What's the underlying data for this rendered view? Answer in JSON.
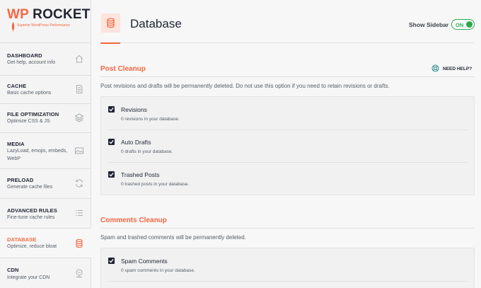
{
  "brand": {
    "logo_wp": "WP",
    "logo_rocket": "ROCKET",
    "tagline": "Superior WordPress Performance"
  },
  "nav": [
    {
      "title": "DASHBOARD",
      "desc": "Get help, account info",
      "icon": "home-icon"
    },
    {
      "title": "CACHE",
      "desc": "Basic cache options",
      "icon": "document-icon"
    },
    {
      "title": "FILE OPTIMIZATION",
      "desc": "Optimize CSS & JS",
      "icon": "layers-icon"
    },
    {
      "title": "MEDIA",
      "desc": "LazyLoad, emojis, embeds, WebP",
      "icon": "image-icon"
    },
    {
      "title": "PRELOAD",
      "desc": "Generate cache files",
      "icon": "refresh-icon"
    },
    {
      "title": "ADVANCED RULES",
      "desc": "Fine-tune cache rules",
      "icon": "list-icon"
    },
    {
      "title": "DATABASE",
      "desc": "Optimize, reduce bloat",
      "icon": "database-icon",
      "active": true
    },
    {
      "title": "CDN",
      "desc": "Integrate your CDN",
      "icon": "cdn-icon"
    }
  ],
  "header": {
    "title": "Database",
    "show_sidebar_label": "Show Sidebar",
    "toggle_label": "ON"
  },
  "post_cleanup": {
    "title": "Post Cleanup",
    "need_help": "NEED HELP?",
    "description": "Post revisions and drafts will be permanently deleted. Do not use this option if you need to retain revisions or drafts.",
    "options": [
      {
        "label": "Revisions",
        "sub": "0 revisions in your database.",
        "checked": true
      },
      {
        "label": "Auto Drafts",
        "sub": "0 drafts in your database.",
        "checked": true
      },
      {
        "label": "Trashed Posts",
        "sub": "0 trashed posts in your database.",
        "checked": true
      }
    ]
  },
  "comments_cleanup": {
    "title": "Comments Cleanup",
    "description": "Spam and trashed comments will be permanently deleted.",
    "options": [
      {
        "label": "Spam Comments",
        "sub": "0 spam comments in your database.",
        "checked": true
      }
    ]
  },
  "colors": {
    "accent": "#f56640",
    "toggle_on": "#2ba94a",
    "dark": "#1f2332"
  }
}
